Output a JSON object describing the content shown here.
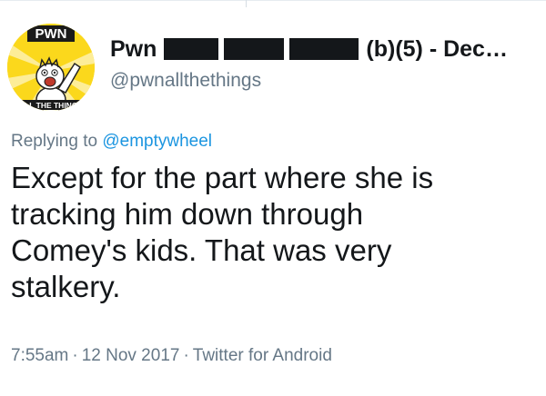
{
  "author": {
    "display_name": "Pwn",
    "name_suffix": "(b)(5) - Dec…",
    "handle": "@pwnallthethings",
    "avatar": {
      "top_text": "PWN",
      "bottom_text": "ALL THE THINGS",
      "background_color": "#fbd81c"
    }
  },
  "reply": {
    "prefix": "Replying to",
    "target": "@emptywheel"
  },
  "tweet": {
    "lines": [
      "Except for the part where she is",
      "tracking him down through",
      "Comey's kids. That was very",
      "stalkery."
    ]
  },
  "meta": {
    "time": "7:55am",
    "separator": "·",
    "date": "12 Nov 2017",
    "source": "Twitter for Android"
  },
  "colors": {
    "text_primary": "#14171a",
    "text_secondary": "#657786",
    "link": "#1b95e0"
  }
}
